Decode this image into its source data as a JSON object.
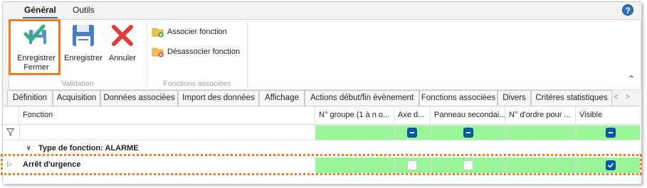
{
  "ribbon_tabs": [
    "Général",
    "Outils"
  ],
  "help_icon": "help-circle-icon",
  "ribbon": {
    "validation": {
      "label": "Validation",
      "buttons": [
        {
          "label_line1": "Enregistrer",
          "label_line2": "Fermer",
          "icon": "save-check-icon"
        },
        {
          "label": "Enregistrer",
          "icon": "floppy-disk-icon"
        },
        {
          "label": "Annuler",
          "icon": "red-x-icon"
        }
      ]
    },
    "fonctions": {
      "label": "Fonctions associées",
      "buttons": [
        {
          "label": "Associer fonction",
          "icon": "folder-add-icon"
        },
        {
          "label": "Désassocier fonction",
          "icon": "folder-remove-icon"
        }
      ]
    },
    "collapse_icon": "chevron-up-icon"
  },
  "tabs": [
    "Définition",
    "Acquisition",
    "Données associées",
    "Import des données",
    "Affichage",
    "Actions début/fin évènement",
    "Fonctions associées",
    "Divers",
    "Critères statistiques"
  ],
  "active_tab": "Fonctions associées",
  "grid": {
    "columns": [
      "Fonction",
      "N° groupe (1 à n o...",
      "Axe d...",
      "Panneau secondai...",
      "N° d'ordre pour ...",
      "Visible"
    ],
    "group_row": "Type de fonction: ALARME",
    "rows": [
      {
        "fonction": "Arrêt d'urgence",
        "axe": false,
        "panneau": false,
        "visible": true
      }
    ]
  },
  "colors": {
    "highlight": "#ee7d1f",
    "green_cell": "#98f598",
    "checkbox": "#0b5aa7"
  }
}
